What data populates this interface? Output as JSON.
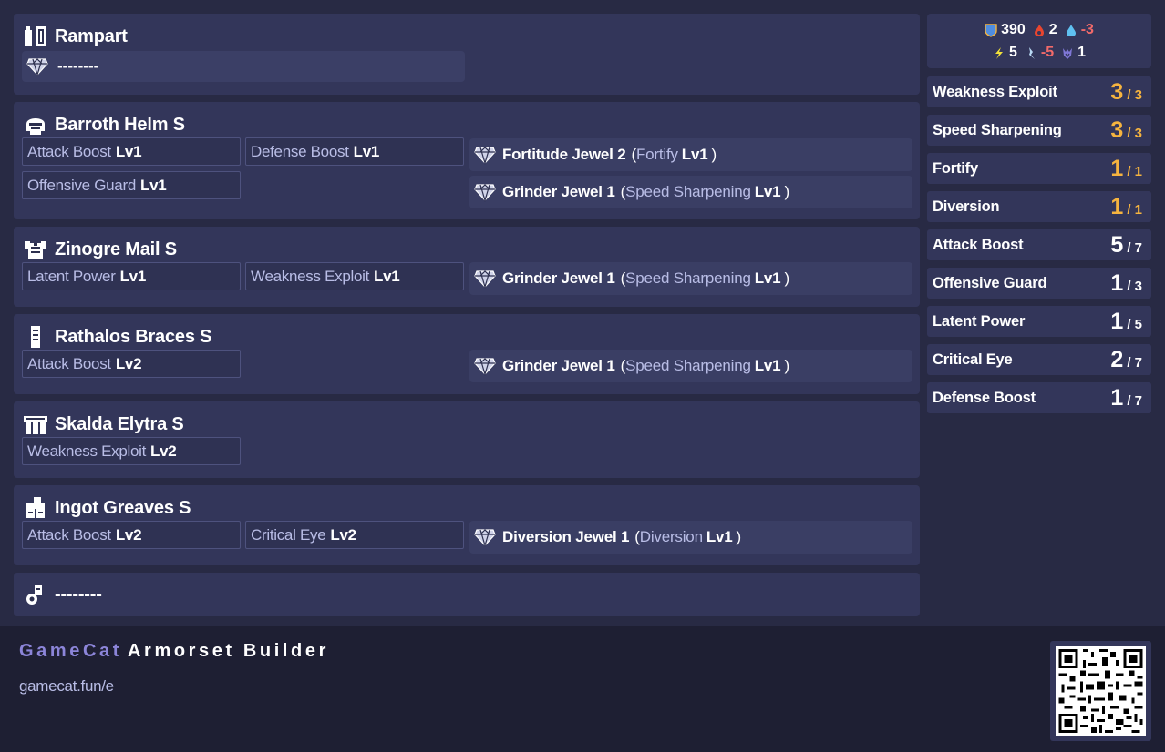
{
  "armor": [
    {
      "slot": "weapon",
      "icon": "weapon-icon",
      "name": "Rampart",
      "empty_slot": "--------"
    },
    {
      "slot": "head",
      "icon": "helm-icon",
      "name": "Barroth Helm S",
      "skills": [
        {
          "name": "Attack Boost",
          "level": "Lv1"
        },
        {
          "name": "Defense Boost",
          "level": "Lv1"
        },
        {
          "name": "Offensive Guard",
          "level": "Lv1"
        }
      ],
      "decorations": [
        {
          "jewel": "Fortitude Jewel 2",
          "skill": "Fortify",
          "level": "Lv1"
        },
        {
          "jewel": "Grinder Jewel 1",
          "skill": "Speed Sharpening",
          "level": "Lv1"
        }
      ]
    },
    {
      "slot": "chest",
      "icon": "mail-icon",
      "name": "Zinogre Mail S",
      "skills": [
        {
          "name": "Latent Power",
          "level": "Lv1"
        },
        {
          "name": "Weakness Exploit",
          "level": "Lv1"
        }
      ],
      "decorations": [
        {
          "jewel": "Grinder Jewel 1",
          "skill": "Speed Sharpening",
          "level": "Lv1"
        }
      ]
    },
    {
      "slot": "arms",
      "icon": "braces-icon",
      "name": "Rathalos Braces S",
      "skills": [
        {
          "name": "Attack Boost",
          "level": "Lv2"
        }
      ],
      "decorations": [
        {
          "jewel": "Grinder Jewel 1",
          "skill": "Speed Sharpening",
          "level": "Lv1"
        }
      ]
    },
    {
      "slot": "waist",
      "icon": "coil-icon",
      "name": "Skalda Elytra S",
      "skills": [
        {
          "name": "Weakness Exploit",
          "level": "Lv2"
        }
      ],
      "decorations": []
    },
    {
      "slot": "legs",
      "icon": "greaves-icon",
      "name": "Ingot Greaves S",
      "skills": [
        {
          "name": "Attack Boost",
          "level": "Lv2"
        },
        {
          "name": "Critical Eye",
          "level": "Lv2"
        }
      ],
      "decorations": [
        {
          "jewel": "Diversion Jewel 1",
          "skill": "Diversion",
          "level": "Lv1"
        }
      ]
    },
    {
      "slot": "talisman",
      "icon": "talisman-icon",
      "name": "--------"
    }
  ],
  "stats": {
    "defense": "390",
    "fire": "2",
    "water": "-3",
    "thunder": "5",
    "ice": "-5",
    "dragon": "1"
  },
  "skill_summary": [
    {
      "name": "Weakness Exploit",
      "current": "3",
      "max": "/ 3",
      "maxed": true
    },
    {
      "name": "Speed Sharpening",
      "current": "3",
      "max": "/ 3",
      "maxed": true
    },
    {
      "name": "Fortify",
      "current": "1",
      "max": "/ 1",
      "maxed": true
    },
    {
      "name": "Diversion",
      "current": "1",
      "max": "/ 1",
      "maxed": true
    },
    {
      "name": "Attack Boost",
      "current": "5",
      "max": "/ 7",
      "maxed": false
    },
    {
      "name": "Offensive Guard",
      "current": "1",
      "max": "/ 3",
      "maxed": false
    },
    {
      "name": "Latent Power",
      "current": "1",
      "max": "/ 5",
      "maxed": false
    },
    {
      "name": "Critical Eye",
      "current": "2",
      "max": "/ 7",
      "maxed": false
    },
    {
      "name": "Defense Boost",
      "current": "1",
      "max": "/ 7",
      "maxed": false
    }
  ],
  "colors": {
    "background": "#282a44",
    "card": "#33365a",
    "skill_text": "#b9bde6",
    "maxed": "#f6b43f",
    "negative": "#f16a6a",
    "brand": "#8c85d9",
    "footer": "#1e1f33"
  },
  "footer": {
    "brand_a": "GameCat",
    "brand_b": "Armorset Builder",
    "url": "gamecat.fun/e"
  }
}
